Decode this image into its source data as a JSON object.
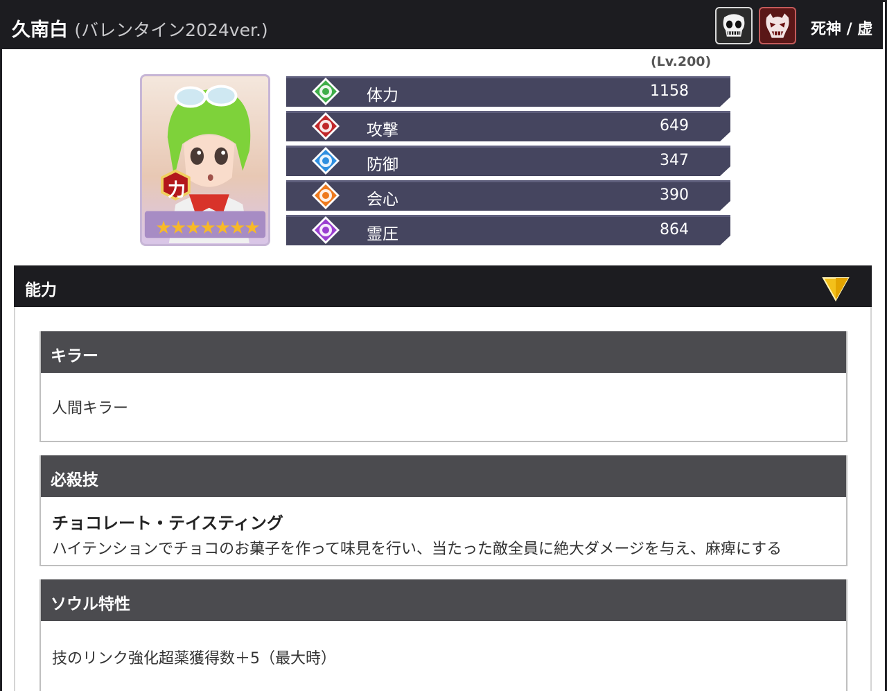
{
  "header": {
    "name": "久南白",
    "variant": "(バレンタイン2024ver.)",
    "affiliation": "死神 / 虚",
    "badge_icons": [
      "skull-mask-icon",
      "hollow-mask-icon"
    ]
  },
  "character": {
    "level": "(Lv.200)",
    "attribute_glyph": "力",
    "stars": "★★★★★★★",
    "stats": [
      {
        "label": "体力",
        "value": "1158",
        "icon": "hp-icon",
        "color": "#3fae49"
      },
      {
        "label": "攻撃",
        "value": "649",
        "icon": "attack-icon",
        "color": "#c0282a"
      },
      {
        "label": "防御",
        "value": "347",
        "icon": "defense-icon",
        "color": "#2f8fe0"
      },
      {
        "label": "会心",
        "value": "390",
        "icon": "critical-icon",
        "color": "#ee7a1e"
      },
      {
        "label": "霊圧",
        "value": "864",
        "icon": "spirit-icon",
        "color": "#9a3fd0"
      }
    ]
  },
  "abilities": {
    "title": "能力",
    "sections": [
      {
        "heading": "キラー",
        "body": "人間キラー"
      },
      {
        "heading": "必殺技",
        "skill_name": "チョコレート・テイスティング",
        "body": "ハイテンションでチョコのお菓子を作って味見を行い、当たった敵全員に絶大ダメージを与え、麻痺にする"
      },
      {
        "heading": "ソウル特性",
        "body": "技のリンク強化超薬獲得数＋5（最大時）"
      }
    ]
  }
}
